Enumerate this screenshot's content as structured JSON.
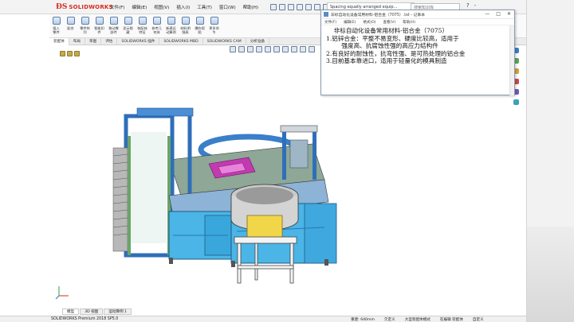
{
  "app": {
    "name": "SOLIDWORKS"
  },
  "menu": [
    "文件(F)",
    "编辑(E)",
    "视图(V)",
    "插入(I)",
    "工具(T)",
    "窗口(W)",
    "帮助(H)"
  ],
  "title_chip": "Spacing equally arranged equip...",
  "search_placeholder": "搜索知识库",
  "help_icons": [
    "?",
    "-"
  ],
  "window_controls": [
    "—",
    "□",
    "✕"
  ],
  "ribbon": [
    {
      "label": "插入\n零件",
      "icon": "insert-part-icon"
    },
    {
      "label": "配合",
      "icon": "mate-icon"
    },
    {
      "label": "零件阵\n列",
      "icon": "pattern-icon"
    },
    {
      "label": "智能扣\n件",
      "icon": "smart-fastener-icon"
    },
    {
      "label": "移动零\n部件",
      "icon": "move-component-icon"
    },
    {
      "label": "显示隐\n藏",
      "icon": "show-hide-icon"
    },
    {
      "label": "装配体\n特征",
      "icon": "assembly-feature-icon"
    },
    {
      "label": "参考几\n何体",
      "icon": "reference-geometry-icon"
    },
    {
      "label": "新建运\n动算例",
      "icon": "motion-study-icon"
    },
    {
      "label": "材料明\n细表",
      "icon": "bom-icon"
    },
    {
      "label": "爆炸视\n图",
      "icon": "exploded-view-icon"
    },
    {
      "label": "更多命\n令",
      "icon": "more-commands-icon"
    }
  ],
  "tabs": [
    "装配体",
    "布局",
    "草图",
    "评估",
    "SOLIDWORKS 插件",
    "SOLIDWORKS MBD",
    "SOLIDWORKS CAM",
    "分析准备"
  ],
  "active_tab_index": 0,
  "notepad": {
    "title": "非标自动化设备常用材料-铝合金（7075）.txt - 记事本",
    "menu": [
      "文件(F)",
      "编辑(E)",
      "格式(O)",
      "查看(V)",
      "帮助(H)"
    ],
    "lines": [
      "    非标自动化设备常用材料-铝合金（7075）",
      "1.铝锌合金：平整不易变形、硬度比较高，适用于",
      "        强度高、抗腐蚀性强的高应力结构件",
      "2.有良好的耐蚀性，抗弯性强、是可热处理的铝合金",
      "3.目前基本靠进口，适用于轻量化的模具制造"
    ],
    "controls": [
      "—",
      "□",
      "✕"
    ]
  },
  "bottom_tabs": [
    "模型",
    "3D 视图",
    "运动算例 1"
  ],
  "active_bottom_tab": 0,
  "status": {
    "left": "SOLIDWORKS Premium 2018 SP5.0",
    "right": [
      "重建: 640mm",
      "欠定义",
      "大型装配体模式",
      "在编辑 装配体",
      "自定义"
    ]
  },
  "colors": {
    "brand": "#d52b1e",
    "frame_blue": "#2f6fb8",
    "panel_cyan": "#4ab5e6",
    "rail_green": "#6aa56a",
    "hopper_yellow": "#f2d64a",
    "fixture_magenta": "#c23ab0"
  }
}
